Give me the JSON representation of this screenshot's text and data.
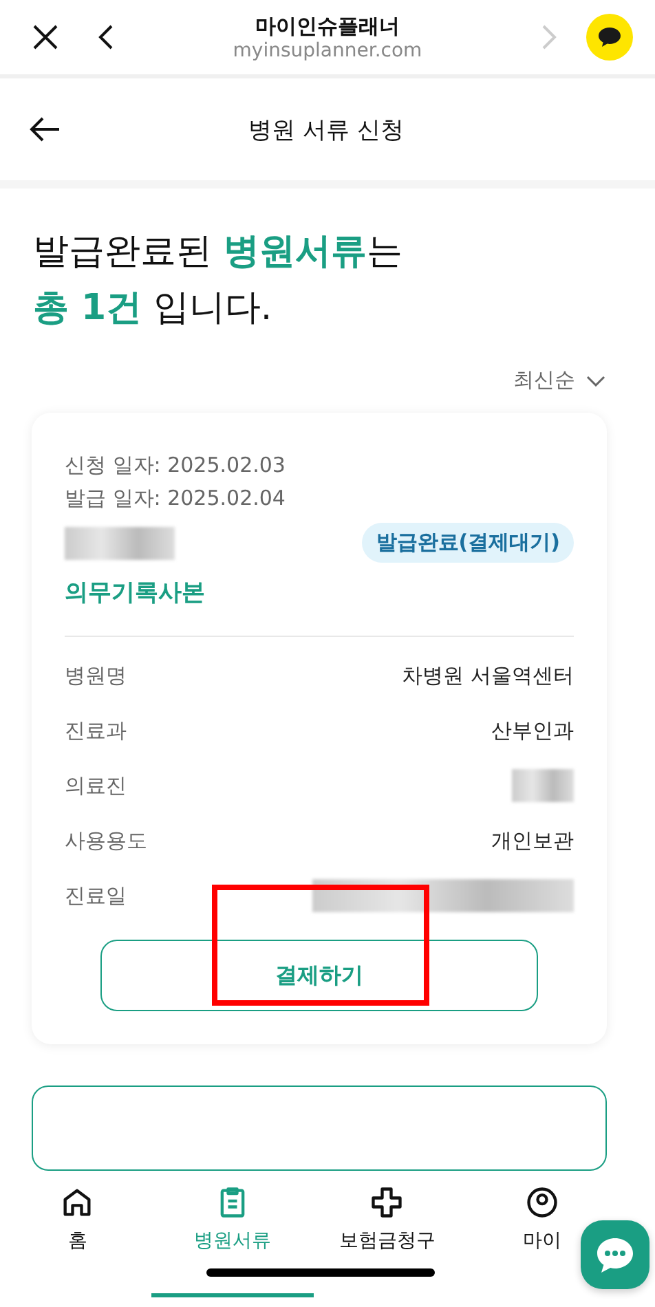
{
  "browser": {
    "title": "마이인슈플래너",
    "url": "myinsuplanner.com",
    "forward_disabled": true
  },
  "header": {
    "title": "병원 서류 신청"
  },
  "heading": {
    "lines": [
      [
        {
          "text": "발급완료된 ",
          "highlight": false
        },
        {
          "text": "병원서류",
          "highlight": true
        },
        {
          "text": "는",
          "highlight": false
        }
      ],
      [
        {
          "text": "총 1건",
          "highlight": true
        },
        {
          "text": " 입니다.",
          "highlight": false
        }
      ]
    ]
  },
  "sort": {
    "label": "최신순"
  },
  "card": {
    "dates": [
      "신청 일자: 2025.02.03",
      "발급 일자: 2025.02.04"
    ],
    "status": "발급완료(결제대기)",
    "document": "의무기록사본",
    "details": [
      {
        "label": "병원명",
        "value": "차병원 서울역센터",
        "kind": "text"
      },
      {
        "label": "진료과",
        "value": "산부인과",
        "kind": "text"
      },
      {
        "label": "의료진",
        "kind": "redacted"
      },
      {
        "label": "사용용도",
        "value": "개인보관",
        "kind": "text"
      },
      {
        "label": "진료일",
        "kind": "redacted"
      }
    ],
    "pay_button": "결제하기",
    "highlighted": true
  },
  "nav": [
    {
      "label": "홈",
      "kind": "home",
      "selected": false
    },
    {
      "label": "병원서류",
      "kind": "clipboard",
      "selected": true
    },
    {
      "label": "보험금청구",
      "kind": "plus",
      "selected": false
    },
    {
      "label": "마이",
      "kind": "user",
      "selected": false
    }
  ]
}
